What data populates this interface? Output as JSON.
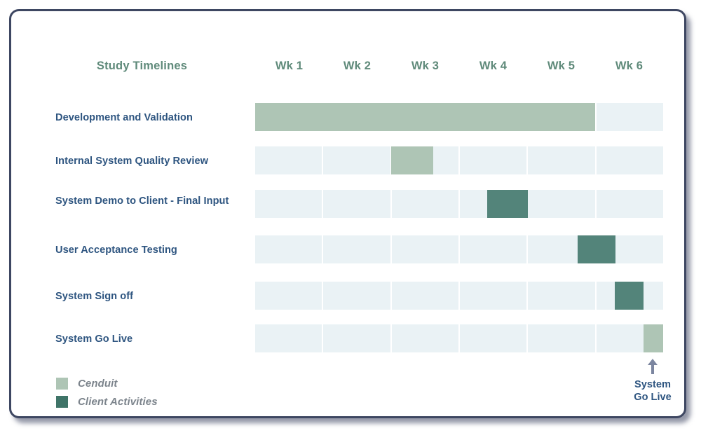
{
  "card": {
    "border_color": "#3e4762",
    "background": "#ffffff"
  },
  "header": {
    "title": "Study Timelines",
    "title_color": "#5f8a7a",
    "week_columns": [
      "Wk 1",
      "Wk 2",
      "Wk 3",
      "Wk 4",
      "Wk 5",
      "Wk 6"
    ]
  },
  "colors": {
    "cenduit": "#aec5b5",
    "client_activities": "#53847a",
    "track": "#eaf2f5",
    "row_label": "#2e5580",
    "week_label": "#5f8a7a",
    "legend_text": "#7c848c"
  },
  "rows": [
    {
      "label": "Development and Validation",
      "category": "Cenduit"
    },
    {
      "label": "Internal System Quality Review",
      "category": "Cenduit"
    },
    {
      "label": "System Demo to Client\n- Final Input",
      "category": "Client Activities"
    },
    {
      "label": "User Acceptance Testing",
      "category": "Client Activities"
    },
    {
      "label": "System Sign off",
      "category": "Client Activities"
    },
    {
      "label": "System Go Live",
      "category": "Cenduit"
    }
  ],
  "legend": [
    {
      "label": "Cenduit",
      "color": "#aec5b5"
    },
    {
      "label": "Client Activities",
      "color": "#3f7468"
    }
  ],
  "annotation": {
    "icon": "arrow-up-icon",
    "text": "System\nGo Live"
  },
  "chart_data": {
    "type": "bar",
    "title": "Study Timelines",
    "xlabel": "",
    "ylabel": "",
    "categories": [
      "Wk 1",
      "Wk 2",
      "Wk 3",
      "Wk 4",
      "Wk 5",
      "Wk 6"
    ],
    "xlim": [
      0,
      6
    ],
    "grid": false,
    "legend": [
      "Cenduit",
      "Client Activities"
    ],
    "legend_position": "bottom-left",
    "tasks": [
      {
        "name": "Development and Validation",
        "series": "Cenduit",
        "start_week": 0.0,
        "end_week": 5.0,
        "duration_weeks": 5.0
      },
      {
        "name": "Internal System Quality Review",
        "series": "Cenduit",
        "start_week": 2.0,
        "end_week": 2.6,
        "duration_weeks": 0.6
      },
      {
        "name": "System Demo to Client - Final Input",
        "series": "Client Activities",
        "start_week": 3.45,
        "end_week": 4.05,
        "duration_weeks": 0.6
      },
      {
        "name": "User Acceptance Testing",
        "series": "Client Activities",
        "start_week": 4.75,
        "end_week": 5.3,
        "duration_weeks": 0.55
      },
      {
        "name": "System Sign off",
        "series": "Client Activities",
        "start_week": 5.3,
        "end_week": 5.7,
        "duration_weeks": 0.4
      },
      {
        "name": "System Go Live",
        "series": "Cenduit",
        "start_week": 5.7,
        "end_week": 6.0,
        "duration_weeks": 0.3
      }
    ]
  }
}
